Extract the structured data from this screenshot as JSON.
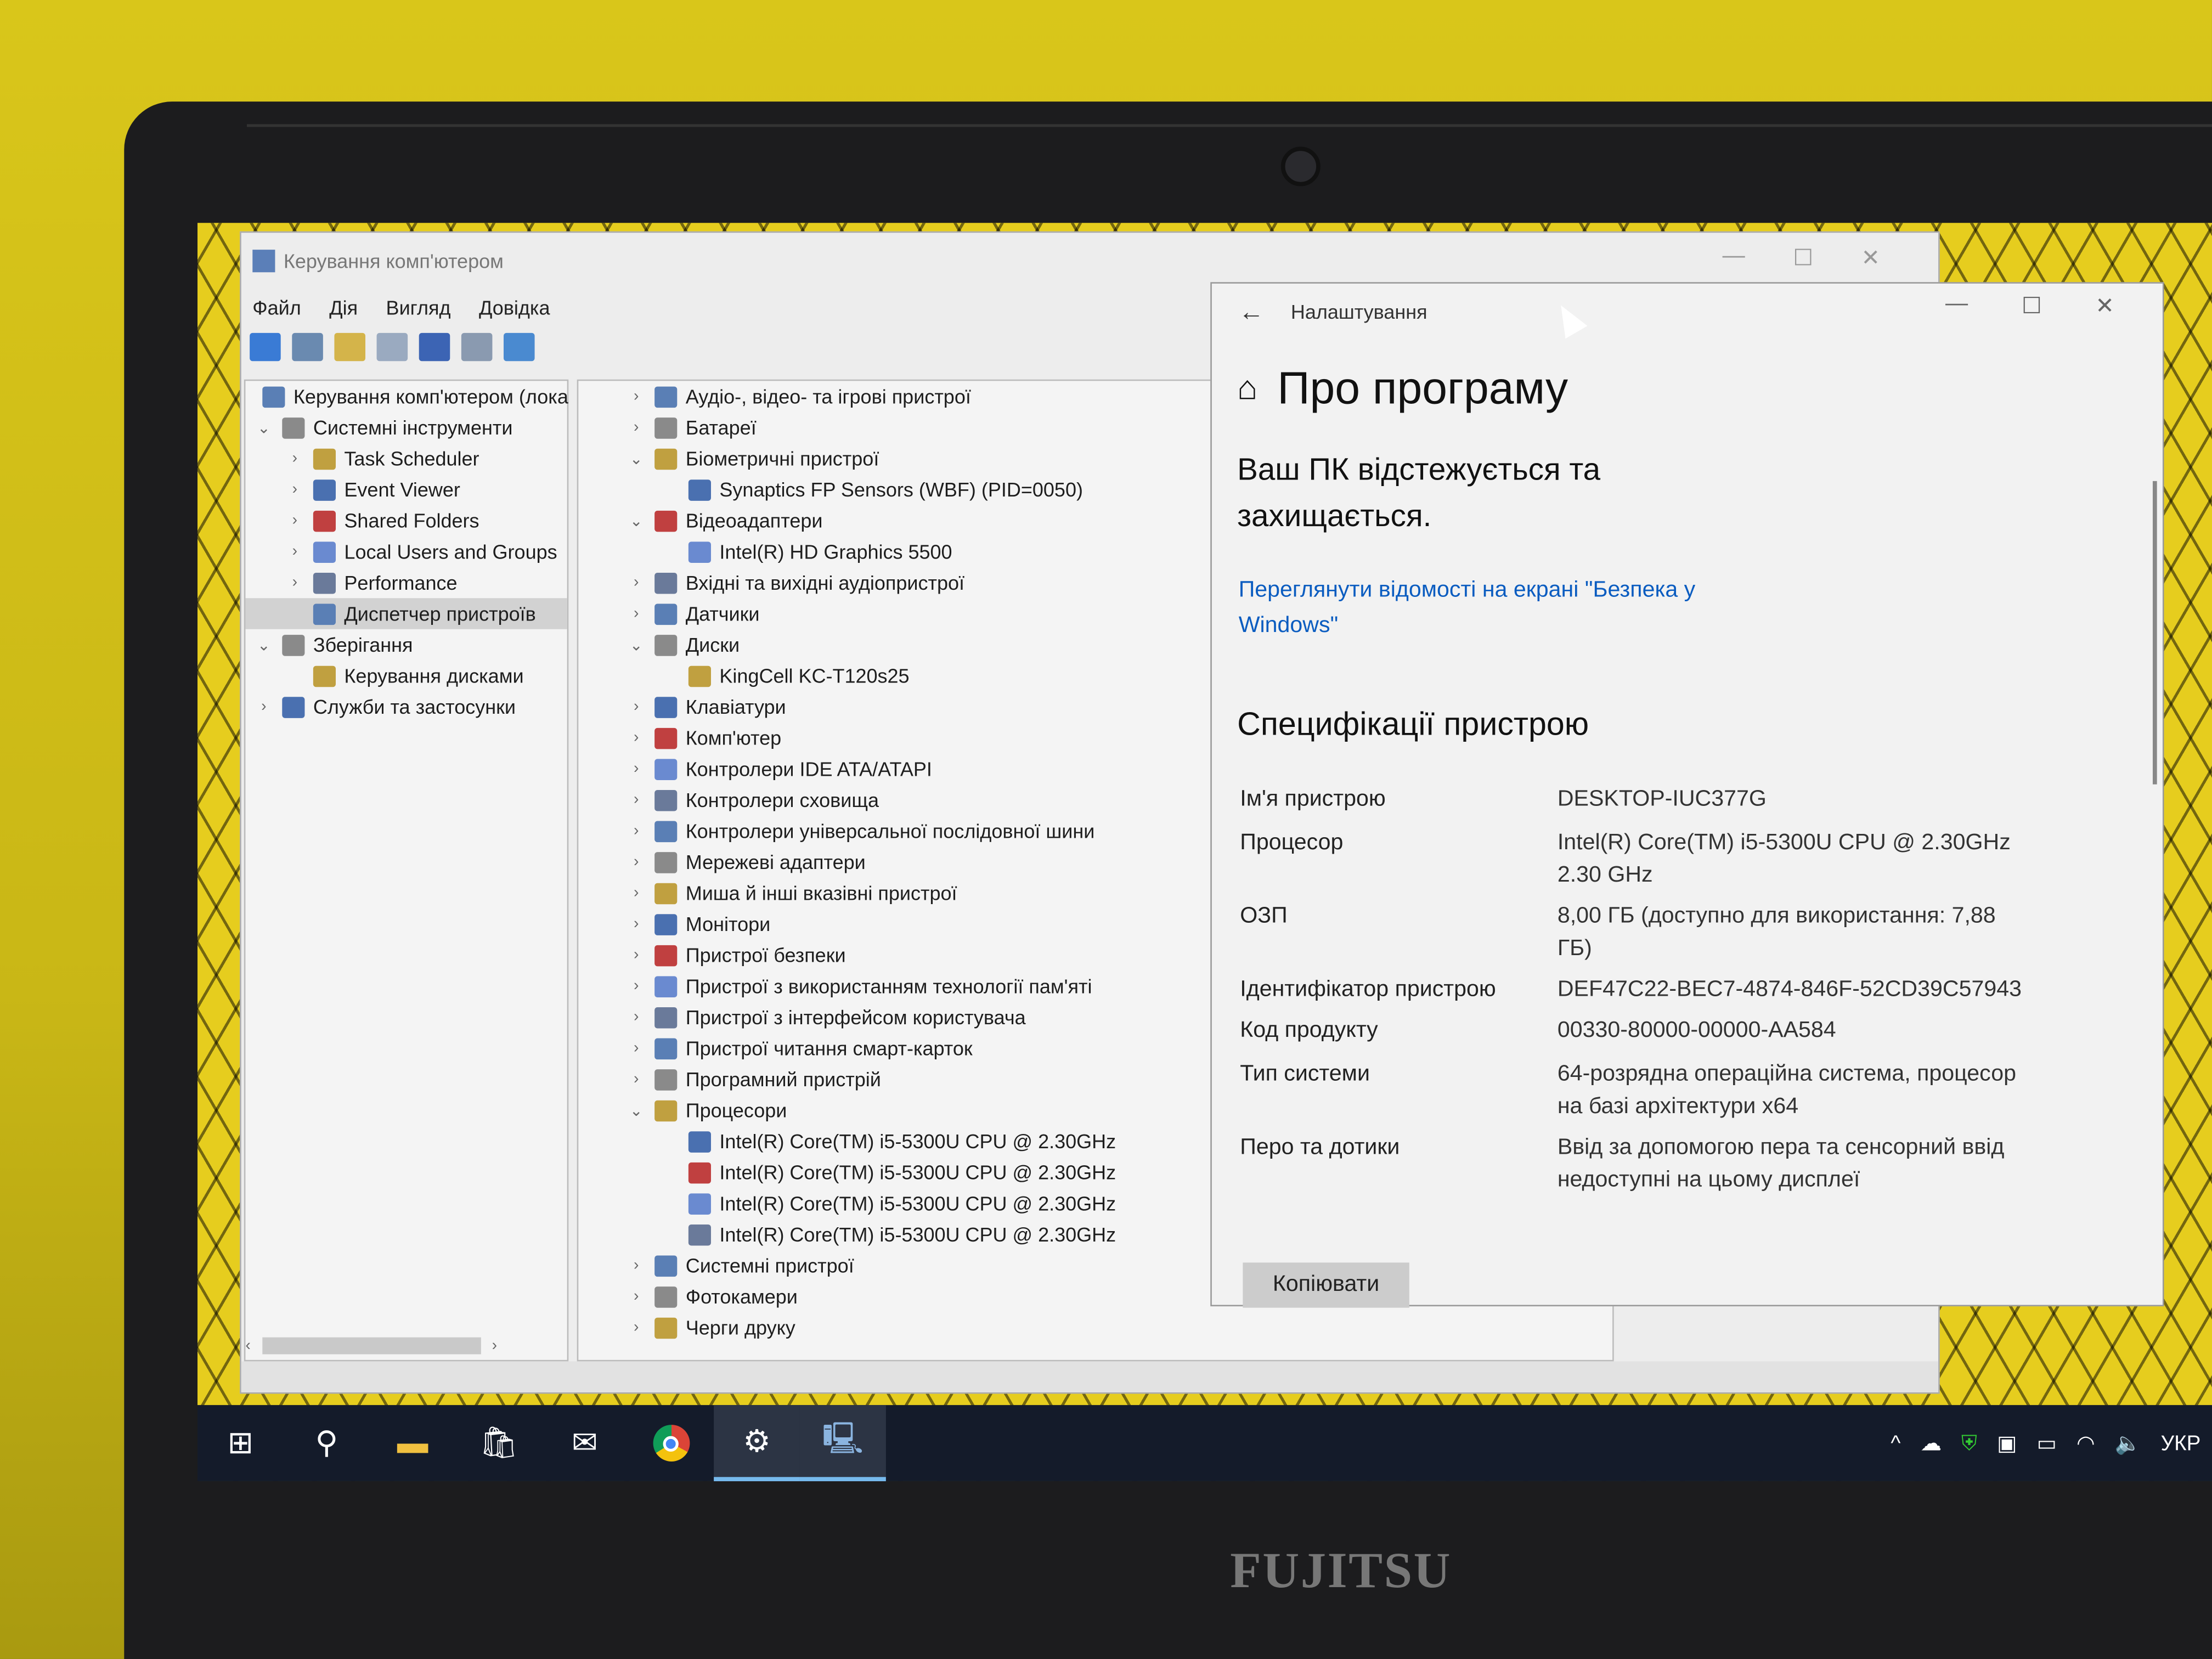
{
  "computer_management": {
    "title": "Керування комп'ютером",
    "menu": [
      "Файл",
      "Дія",
      "Вигляд",
      "Довідка"
    ],
    "tree": [
      {
        "label": "Керування комп'ютером (лока",
        "level": 0,
        "chev": ""
      },
      {
        "label": "Системні інструменти",
        "level": 0,
        "chev": "v"
      },
      {
        "label": "Task Scheduler",
        "level": 1,
        "chev": ">"
      },
      {
        "label": "Event Viewer",
        "level": 1,
        "chev": ">"
      },
      {
        "label": "Shared Folders",
        "level": 1,
        "chev": ">"
      },
      {
        "label": "Local Users and Groups",
        "level": 1,
        "chev": ">"
      },
      {
        "label": "Performance",
        "level": 1,
        "chev": ">"
      },
      {
        "label": "Диспетчер пристроїв",
        "level": 1,
        "chev": "",
        "selected": true
      },
      {
        "label": "Зберігання",
        "level": 0,
        "chev": "v"
      },
      {
        "label": "Керування дисками",
        "level": 1,
        "chev": ""
      },
      {
        "label": "Служби та застосунки",
        "level": 0,
        "chev": ">"
      }
    ],
    "devices": [
      {
        "label": "Аудіо-, відео- та ігрові пристрої",
        "level": 0,
        "chev": ">"
      },
      {
        "label": "Батареї",
        "level": 0,
        "chev": ">"
      },
      {
        "label": "Біометричні пристрої",
        "level": 0,
        "chev": "v"
      },
      {
        "label": "Synaptics FP Sensors (WBF) (PID=0050)",
        "level": 1,
        "chev": ""
      },
      {
        "label": "Відеоадаптери",
        "level": 0,
        "chev": "v"
      },
      {
        "label": "Intel(R) HD Graphics 5500",
        "level": 1,
        "chev": ""
      },
      {
        "label": "Вхідні та вихідні аудіопристрої",
        "level": 0,
        "chev": ">"
      },
      {
        "label": "Датчики",
        "level": 0,
        "chev": ">"
      },
      {
        "label": "Диски",
        "level": 0,
        "chev": "v"
      },
      {
        "label": "KingCell KC-T120s25",
        "level": 1,
        "chev": ""
      },
      {
        "label": "Клавіатури",
        "level": 0,
        "chev": ">"
      },
      {
        "label": "Комп'ютер",
        "level": 0,
        "chev": ">"
      },
      {
        "label": "Контролери IDE ATA/ATAPI",
        "level": 0,
        "chev": ">"
      },
      {
        "label": "Контролери сховища",
        "level": 0,
        "chev": ">"
      },
      {
        "label": "Контролери універсальної послідовної шини",
        "level": 0,
        "chev": ">"
      },
      {
        "label": "Мережеві адаптери",
        "level": 0,
        "chev": ">"
      },
      {
        "label": "Миша й інші вказівні пристрої",
        "level": 0,
        "chev": ">"
      },
      {
        "label": "Монітори",
        "level": 0,
        "chev": ">"
      },
      {
        "label": "Пристрої безпеки",
        "level": 0,
        "chev": ">"
      },
      {
        "label": "Пристрої з використанням технології пам'яті",
        "level": 0,
        "chev": ">"
      },
      {
        "label": "Пристрої з інтерфейсом користувача",
        "level": 0,
        "chev": ">"
      },
      {
        "label": "Пристрої читання смарт-карток",
        "level": 0,
        "chev": ">"
      },
      {
        "label": "Програмний пристрій",
        "level": 0,
        "chev": ">"
      },
      {
        "label": "Процесори",
        "level": 0,
        "chev": "v"
      },
      {
        "label": "Intel(R) Core(TM) i5-5300U CPU @ 2.30GHz",
        "level": 1,
        "chev": ""
      },
      {
        "label": "Intel(R) Core(TM) i5-5300U CPU @ 2.30GHz",
        "level": 1,
        "chev": ""
      },
      {
        "label": "Intel(R) Core(TM) i5-5300U CPU @ 2.30GHz",
        "level": 1,
        "chev": ""
      },
      {
        "label": "Intel(R) Core(TM) i5-5300U CPU @ 2.30GHz",
        "level": 1,
        "chev": ""
      },
      {
        "label": "Системні пристрої",
        "level": 0,
        "chev": ">"
      },
      {
        "label": "Фотокамери",
        "level": 0,
        "chev": ">"
      },
      {
        "label": "Черги друку",
        "level": 0,
        "chev": ">"
      }
    ]
  },
  "settings": {
    "window_title": "Налаштування",
    "page_title": "Про програму",
    "protection_status": "Ваш ПК відстежується та захищається.",
    "security_link": "Переглянути відомості на екрані \"Безпека у Windows\"",
    "specs_heading": "Специфікації пристрою",
    "specs": [
      {
        "key": "Ім'я пристрою",
        "value": "DESKTOP-IUC377G"
      },
      {
        "key": "Процесор",
        "value": "Intel(R) Core(TM) i5-5300U CPU @ 2.30GHz   2.30 GHz"
      },
      {
        "key": "ОЗП",
        "value": "8,00 ГБ (доступно для використання: 7,88 ГБ)"
      },
      {
        "key": "Ідентифікатор пристрою",
        "value": "DEF47C22-BEC7-4874-846F-52CD39C57943"
      },
      {
        "key": "Код продукту",
        "value": "00330-80000-00000-AA584"
      },
      {
        "key": "Тип системи",
        "value": "64-розрядна операційна система, процесор на базі архітектури x64"
      },
      {
        "key": "Перо та дотики",
        "value": "Ввід за допомогою пера та сенсорний ввід недоступні на цьому дисплеї"
      }
    ],
    "copy_label": "Копіювати"
  },
  "taskbar": {
    "apps": [
      "start-icon",
      "search-icon",
      "file-explorer-icon",
      "store-icon",
      "mail-icon",
      "chrome-icon",
      "settings-icon",
      "computer-management-icon"
    ],
    "active": "settings-icon",
    "language": "УКР"
  },
  "laptop_brand": "FUJITSU"
}
